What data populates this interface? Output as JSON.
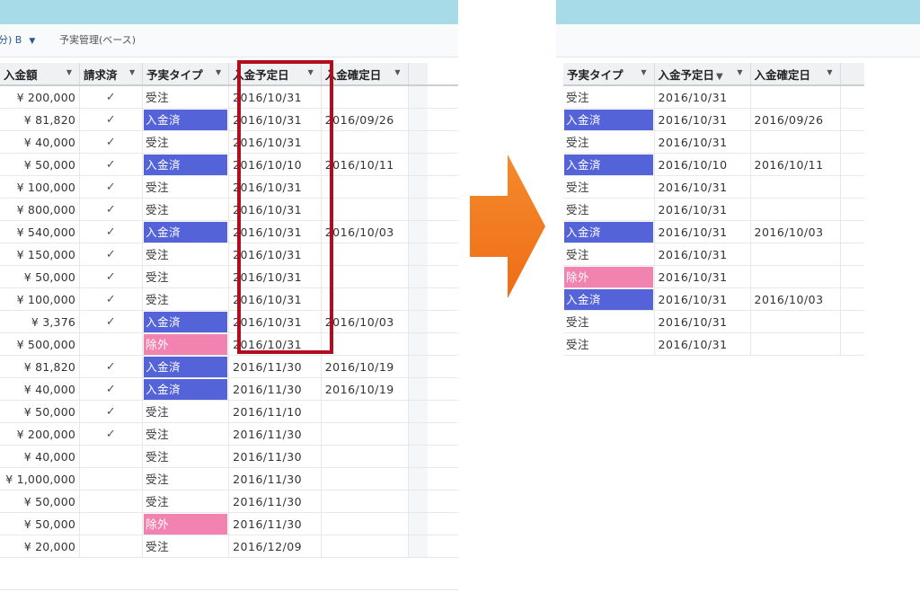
{
  "left": {
    "tabs": [
      {
        "label": "分) B",
        "caret": "▼"
      },
      {
        "label": "予実管理(ベース)"
      }
    ],
    "columns": [
      "入金額",
      "請求済",
      "予実タイプ",
      "入金予定日",
      "入金確定日"
    ],
    "check_glyph": "✓",
    "rows": [
      {
        "amount": "¥ 200,000",
        "billed": true,
        "type": "受注",
        "type_color": "order",
        "planned": "2016/10/31",
        "confirmed": ""
      },
      {
        "amount": "¥ 81,820",
        "billed": true,
        "type": "入金済",
        "type_color": "deposited",
        "planned": "2016/10/31",
        "confirmed": "2016/09/26"
      },
      {
        "amount": "¥ 40,000",
        "billed": true,
        "type": "受注",
        "type_color": "order",
        "planned": "2016/10/31",
        "confirmed": ""
      },
      {
        "amount": "¥ 50,000",
        "billed": true,
        "type": "入金済",
        "type_color": "deposited",
        "planned": "2016/10/10",
        "confirmed": "2016/10/11"
      },
      {
        "amount": "¥ 100,000",
        "billed": true,
        "type": "受注",
        "type_color": "order",
        "planned": "2016/10/31",
        "confirmed": ""
      },
      {
        "amount": "¥ 800,000",
        "billed": true,
        "type": "受注",
        "type_color": "order",
        "planned": "2016/10/31",
        "confirmed": ""
      },
      {
        "amount": "¥ 540,000",
        "billed": true,
        "type": "入金済",
        "type_color": "deposited",
        "planned": "2016/10/31",
        "confirmed": "2016/10/03"
      },
      {
        "amount": "¥ 150,000",
        "billed": true,
        "type": "受注",
        "type_color": "order",
        "planned": "2016/10/31",
        "confirmed": ""
      },
      {
        "amount": "¥ 50,000",
        "billed": true,
        "type": "受注",
        "type_color": "order",
        "planned": "2016/10/31",
        "confirmed": ""
      },
      {
        "amount": "¥ 100,000",
        "billed": true,
        "type": "受注",
        "type_color": "order",
        "planned": "2016/10/31",
        "confirmed": ""
      },
      {
        "amount": "¥ 3,376",
        "billed": true,
        "type": "入金済",
        "type_color": "deposited",
        "planned": "2016/10/31",
        "confirmed": "2016/10/03"
      },
      {
        "amount": "¥ 500,000",
        "billed": false,
        "type": "除外",
        "type_color": "excluded",
        "planned": "2016/10/31",
        "confirmed": ""
      },
      {
        "amount": "¥ 81,820",
        "billed": true,
        "type": "入金済",
        "type_color": "deposited",
        "planned": "2016/11/30",
        "confirmed": "2016/10/19"
      },
      {
        "amount": "¥ 40,000",
        "billed": true,
        "type": "入金済",
        "type_color": "deposited",
        "planned": "2016/11/30",
        "confirmed": "2016/10/19"
      },
      {
        "amount": "¥ 50,000",
        "billed": true,
        "type": "受注",
        "type_color": "order",
        "planned": "2016/11/10",
        "confirmed": ""
      },
      {
        "amount": "¥ 200,000",
        "billed": true,
        "type": "受注",
        "type_color": "order",
        "planned": "2016/11/30",
        "confirmed": ""
      },
      {
        "amount": "¥ 40,000",
        "billed": false,
        "type": "受注",
        "type_color": "order",
        "planned": "2016/11/30",
        "confirmed": ""
      },
      {
        "amount": "¥ 1,000,000",
        "billed": false,
        "type": "受注",
        "type_color": "order",
        "planned": "2016/11/30",
        "confirmed": ""
      },
      {
        "amount": "¥ 50,000",
        "billed": false,
        "type": "受注",
        "type_color": "order",
        "planned": "2016/11/30",
        "confirmed": ""
      },
      {
        "amount": "¥ 50,000",
        "billed": false,
        "type": "除外",
        "type_color": "excluded",
        "planned": "2016/11/30",
        "confirmed": ""
      },
      {
        "amount": "¥ 20,000",
        "billed": false,
        "type": "受注",
        "type_color": "order",
        "planned": "2016/12/09",
        "confirmed": ""
      }
    ]
  },
  "right": {
    "columns": [
      "予実タイプ",
      "入金予定日",
      "入金確定日"
    ],
    "filter_glyph": "▼",
    "rows": [
      {
        "type": "受注",
        "type_color": "order",
        "planned": "2016/10/31",
        "confirmed": ""
      },
      {
        "type": "入金済",
        "type_color": "deposited",
        "planned": "2016/10/31",
        "confirmed": "2016/09/26"
      },
      {
        "type": "受注",
        "type_color": "order",
        "planned": "2016/10/31",
        "confirmed": ""
      },
      {
        "type": "入金済",
        "type_color": "deposited",
        "planned": "2016/10/10",
        "confirmed": "2016/10/11"
      },
      {
        "type": "受注",
        "type_color": "order",
        "planned": "2016/10/31",
        "confirmed": ""
      },
      {
        "type": "受注",
        "type_color": "order",
        "planned": "2016/10/31",
        "confirmed": ""
      },
      {
        "type": "入金済",
        "type_color": "deposited",
        "planned": "2016/10/31",
        "confirmed": "2016/10/03"
      },
      {
        "type": "受注",
        "type_color": "order",
        "planned": "2016/10/31",
        "confirmed": ""
      },
      {
        "type": "除外",
        "type_color": "excluded",
        "planned": "2016/10/31",
        "confirmed": ""
      },
      {
        "type": "入金済",
        "type_color": "deposited",
        "planned": "2016/10/31",
        "confirmed": "2016/10/03"
      },
      {
        "type": "受注",
        "type_color": "order",
        "planned": "2016/10/31",
        "confirmed": ""
      },
      {
        "type": "受注",
        "type_color": "order",
        "planned": "2016/10/31",
        "confirmed": ""
      }
    ]
  },
  "colors": {
    "header_bar": "#a8dbe8",
    "deposited": "#5463d8",
    "excluded": "#f283b0",
    "highlight": "#b20d1e",
    "arrow": "#f07a22"
  },
  "icons": {
    "dropdown": "chevron-down-icon",
    "check": "check-icon",
    "filter": "filter-icon",
    "arrow": "right-arrow-icon"
  }
}
